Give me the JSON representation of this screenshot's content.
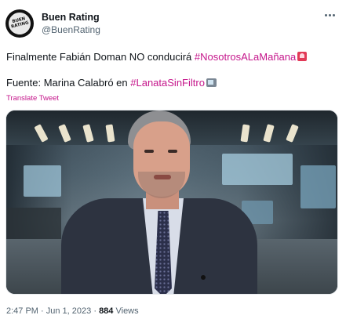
{
  "account": {
    "display_name": "Buen Rating",
    "handle": "@BuenRating",
    "avatar_text_line1": "BUEN",
    "avatar_text_line2": "RATING"
  },
  "tweet": {
    "line1_text": "Finalmente Fabián Doman NO conducirá ",
    "line1_hashtag": "#NosotrosALaMañana",
    "line2_text": "Fuente: Marina Calabró en ",
    "line2_hashtag": "#LanataSinFiltro",
    "translate_label": "Translate Tweet"
  },
  "meta": {
    "time": "2:47 PM",
    "separator1": "·",
    "date": "Jun 1, 2023",
    "separator2": "·",
    "views_count": "884",
    "views_label": "Views"
  },
  "colors": {
    "hashtag": "#c5168b",
    "text": "#0f1419",
    "secondary": "#536471"
  },
  "icons": {
    "more": "more-dots-icon",
    "siren": "siren-emoji-icon",
    "tv": "tv-emoji-icon"
  }
}
